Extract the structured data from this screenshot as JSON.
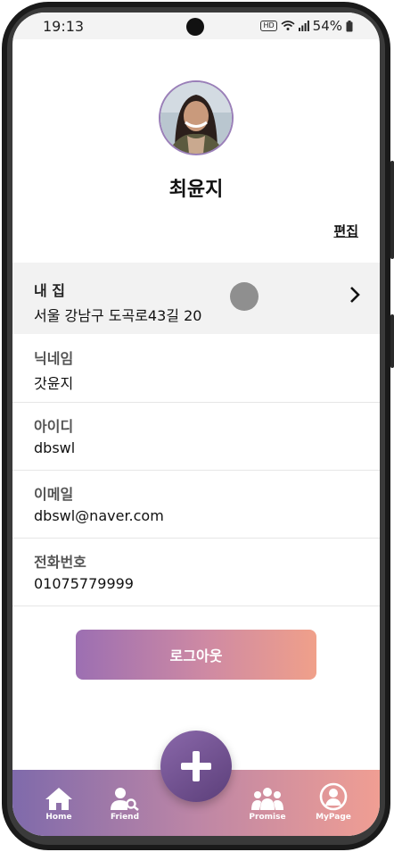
{
  "status_bar": {
    "time": "19:13",
    "hd": "HD",
    "battery": "54%"
  },
  "profile": {
    "name": "최윤지",
    "edit_label": "편집"
  },
  "home": {
    "label": "내 집",
    "address": "서울 강남구 도곡로43길 20"
  },
  "fields": [
    {
      "label": "닉네임",
      "value": "갓윤지"
    },
    {
      "label": "아이디",
      "value": "dbswl"
    },
    {
      "label": "이메일",
      "value": "dbswl@naver.com"
    },
    {
      "label": "전화번호",
      "value": "01075779999"
    }
  ],
  "logout_label": "로그아웃",
  "tabbar": {
    "home": "Home",
    "friend": "Friend",
    "promise": "Promise",
    "mypage": "MyPage"
  },
  "colors": {
    "accent_start": "#9c6fb2",
    "accent_end": "#f0a08a",
    "fab": "#6b4c8a"
  }
}
